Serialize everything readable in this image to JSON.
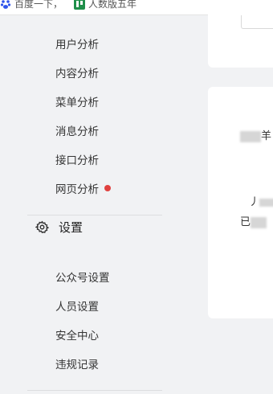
{
  "bookmarks": [
    {
      "label": "百度一下，",
      "icon": "baidu-paw-icon"
    },
    {
      "label": "人数版五年",
      "icon": "green-bookmark-icon"
    }
  ],
  "sidebar": {
    "analysis_items": [
      {
        "label": "用户分析"
      },
      {
        "label": "内容分析"
      },
      {
        "label": "菜单分析"
      },
      {
        "label": "消息分析"
      },
      {
        "label": "接口分析"
      },
      {
        "label": "网页分析",
        "badge": "red-dot"
      }
    ],
    "settings": {
      "title": "设置",
      "icon": "gear-icon",
      "items": [
        {
          "label": "公众号设置"
        },
        {
          "label": "人员设置"
        },
        {
          "label": "安全中心"
        },
        {
          "label": "违规记录"
        }
      ]
    }
  },
  "cards": {
    "peek_text_1": "羊",
    "peek_text_2": "已",
    "peek_text_3": "丿"
  },
  "colors": {
    "background": "#f1f2f4",
    "card": "#ffffff",
    "badge": "#e0413f",
    "text": "#353535"
  }
}
